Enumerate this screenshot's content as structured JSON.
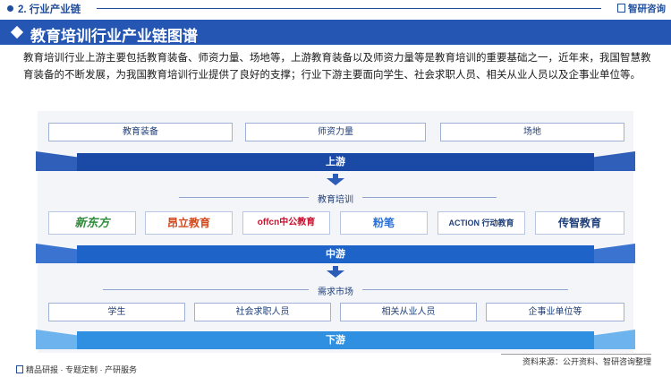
{
  "header": {
    "section": "2. 行业产业链",
    "brand": "智研咨询"
  },
  "title": "教育培训行业产业链图谱",
  "intro": "教育培训行业上游主要包括教育装备、师资力量、场地等，上游教育装备以及师资力量等是教育培训的重要基础之一，近年来，我国智慧教育装备的不断发展，为我国教育培训行业提供了良好的支撑；行业下游主要面向学生、社会求职人员、相关从业人员以及企事业单位等。",
  "upstream": {
    "items": [
      "教育装备",
      "师资力量",
      "场地"
    ],
    "band": "上游"
  },
  "midstream": {
    "label": "教育培训",
    "logos": [
      {
        "name": "新东方",
        "color": "#2e8b3a"
      },
      {
        "name": "昂立教育",
        "color": "#d04a1e"
      },
      {
        "name": "offcn中公教育",
        "color": "#c8102e"
      },
      {
        "name": "粉笔",
        "color": "#2a6fd6"
      },
      {
        "name": "ACTION 行动教育",
        "color": "#1f3f7a"
      },
      {
        "name": "传智教育",
        "color": "#1f3f7a"
      }
    ],
    "band": "中游"
  },
  "downstream": {
    "label": "需求市场",
    "items": [
      "学生",
      "社会求职人员",
      "相关从业人员",
      "企事业单位等"
    ],
    "band": "下游"
  },
  "footer": {
    "left": "精品研报 · 专题定制 · 产研服务",
    "right": "资料来源：公开资料、智研咨询整理"
  },
  "colors": {
    "primary": "#2656b4",
    "band_upstream": "#1a4fb0",
    "band_midstream": "#1e63c8",
    "band_downstream": "#2f8fe0"
  }
}
